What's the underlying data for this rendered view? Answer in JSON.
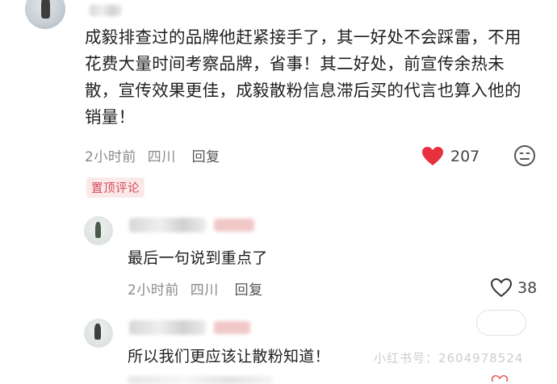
{
  "main_comment": {
    "username": "",
    "text": "成毅排查过的品牌他赶紧接手了，其一好处不会踩雷，不用花费大量时间考察品牌，省事！其二好处，前宣传余热未散，宣传效果更佳，成毅散粉信息滞后买的代言也算入他的销量！",
    "time": "2小时前",
    "location": "四川",
    "reply_label": "回复",
    "like_count": "207",
    "like_icon": "heart-filled-icon",
    "dislike_icon": "neutral-face-icon",
    "badge": "置顶评论",
    "colors": {
      "heart": "#e8303f",
      "badge_text": "#d24b55",
      "badge_bg": "#fbe9ea"
    }
  },
  "replies": [
    {
      "username": "",
      "text": "最后一句说到重点了",
      "time": "2小时前",
      "location": "四川",
      "reply_label": "回复",
      "like_count": "38",
      "like_icon": "heart-outline-icon"
    },
    {
      "username": "",
      "text": "所以我们更应该让散粉知道！",
      "time": "",
      "location": "",
      "reply_label": "",
      "like_count": ""
    }
  ],
  "watermark": {
    "text": "小红书号：2604978524"
  }
}
